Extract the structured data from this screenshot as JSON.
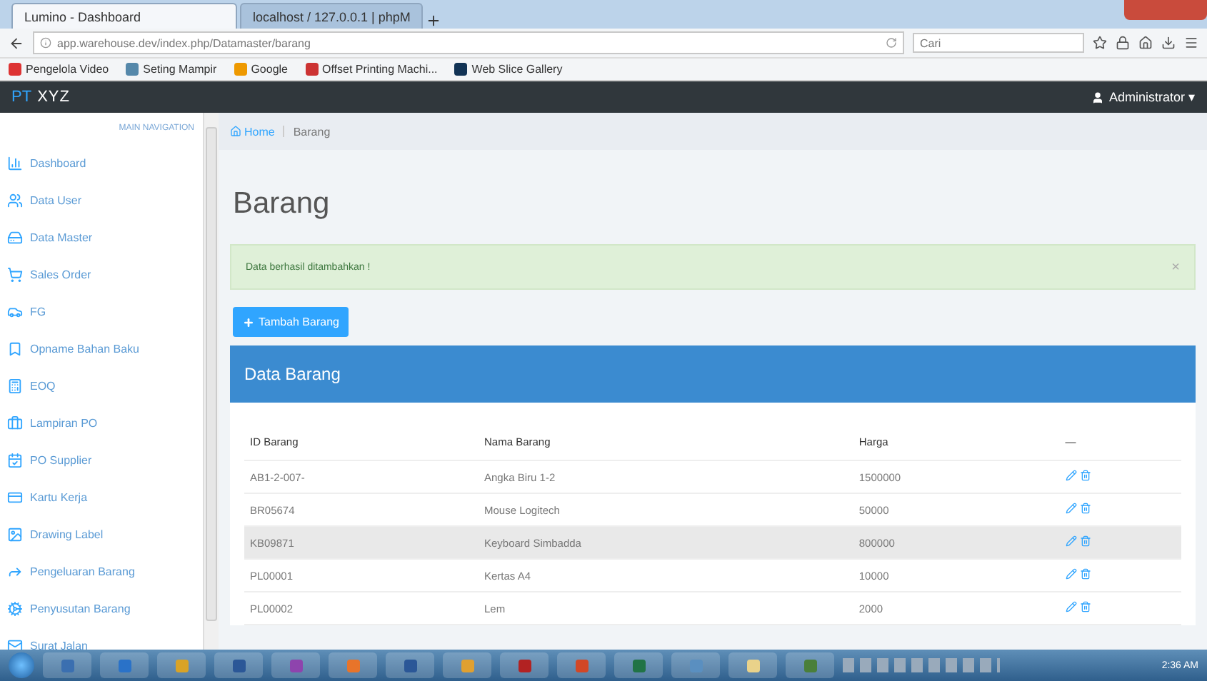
{
  "browser": {
    "tabs": [
      {
        "title": "Lumino - Dashboard",
        "selected": true
      },
      {
        "title": "localhost / 127.0.0.1 | phpM",
        "selected": false
      }
    ],
    "url": "app.warehouse.dev/index.php/Datamaster/barang",
    "search": {
      "placeholder": "Cari"
    },
    "bookmarks": [
      "Pengelola Video",
      "Seting Mampir",
      "Google",
      "Offset Printing Machi...",
      "Web Slice Gallery"
    ]
  },
  "navbar": {
    "brand_prefix": "PT",
    "brand_name": "XYZ",
    "user": "Administrator",
    "user_caret": "▾"
  },
  "sidebar": {
    "heading": "MAIN NAVIGATION",
    "items": [
      {
        "label": "Dashboard"
      },
      {
        "label": "Data User"
      },
      {
        "label": "Data Master"
      },
      {
        "label": "Sales Order"
      },
      {
        "label": "FG"
      },
      {
        "label": "Opname Bahan Baku"
      },
      {
        "label": "EOQ"
      },
      {
        "label": "Lampiran PO"
      },
      {
        "label": "PO Supplier"
      },
      {
        "label": "Kartu Kerja"
      },
      {
        "label": "Drawing Label"
      },
      {
        "label": "Pengeluaran Barang"
      },
      {
        "label": "Penyusutan Barang"
      },
      {
        "label": "Surat Jalan"
      }
    ]
  },
  "breadcrumb": [
    "Home",
    "Barang"
  ],
  "page_title": "Barang",
  "alert": {
    "message": "Data berhasil ditambahkan !",
    "close": "×"
  },
  "add_button": "Tambah Barang",
  "panel": {
    "title": "Data Barang",
    "table": {
      "columns": [
        "ID Barang",
        "Nama Barang",
        "Harga",
        "—"
      ],
      "rows": [
        {
          "id": "AB1-2-007-",
          "name": "Angka Biru 1-2",
          "price": "1500000",
          "highlighted": false
        },
        {
          "id": "BR05674",
          "name": "Mouse Logitech",
          "price": "50000",
          "highlighted": false
        },
        {
          "id": "KB09871",
          "name": "Keyboard Simbadda",
          "price": "800000",
          "highlighted": true
        },
        {
          "id": "PL00001",
          "name": "Kertas A4",
          "price": "10000",
          "highlighted": false
        },
        {
          "id": "PL00002",
          "name": "Lem",
          "price": "2000",
          "highlighted": false
        }
      ]
    }
  },
  "taskbar": {
    "clock": "2:36 AM"
  }
}
